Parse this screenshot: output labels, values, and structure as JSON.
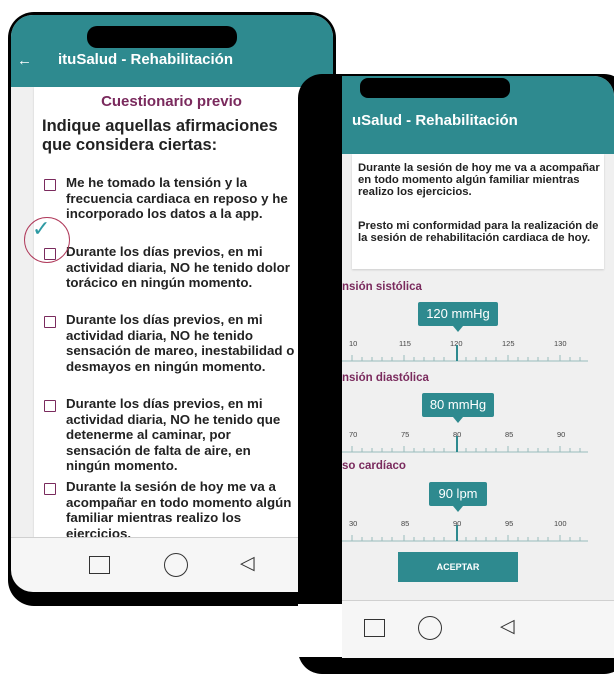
{
  "left_screen": {
    "app_title": "ituSalud - Rehabilitación",
    "back_icon": "arrow-left-icon",
    "questionnaire_title": "Cuestionario previo",
    "instruction": "Indique aquellas afirmaciones que considera ciertas:",
    "statements": [
      {
        "text": "Me he tomado la tensión y la frecuencia cardiaca en reposo y he incorporado los datos a la app.",
        "checked": false
      },
      {
        "text": "Durante los días previos, en mi actividad diaria, NO he tenido dolor torácico en ningún momento.",
        "checked": false
      },
      {
        "text": "Durante los días previos, en mi actividad diaria, NO he tenido sensación de mareo, inestabilidad o desmayos en ningún momento.",
        "checked": false
      },
      {
        "text": "Durante los días previos, en mi actividad diaria, NO he tenido que detenerme al caminar, por sensación de falta de aire, en ningún momento.",
        "checked": false
      },
      {
        "text": "Durante la sesión de hoy me va a acompañar en todo momento algún familiar mientras realizo los ejercicios.",
        "checked": false
      }
    ],
    "annotation_icon": "checkmark-icon"
  },
  "right_screen": {
    "app_title": "uSalud - Rehabilitación",
    "card_paragraph_1": "Durante la sesión de hoy me va a acompañar en todo momento algún familiar mientras realizo los ejercicios.",
    "card_paragraph_2": "Presto mi conformidad para la realización de la sesión de rehabilitación cardiaca de hoy.",
    "sliders": [
      {
        "label": "nsión sistólica",
        "value_text": "120 mmHg",
        "value": 120,
        "ticks": [
          "10",
          "115",
          "120",
          "125",
          "130"
        ]
      },
      {
        "label": "nsión diastólica",
        "value_text": "80 mmHg",
        "value": 80,
        "ticks": [
          "70",
          "75",
          "80",
          "85",
          "90"
        ]
      },
      {
        "label": "so cardíaco",
        "value_text": "90 lpm",
        "value": 90,
        "ticks": [
          "30",
          "85",
          "90",
          "95",
          "100"
        ]
      }
    ],
    "accept_button": "ACEPTAR"
  },
  "nav_icons": {
    "recents": "square-icon",
    "home": "circle-icon",
    "back": "triangle-back-icon"
  },
  "colors": {
    "primary": "#2e8a8f",
    "accent": "#7a2a5d",
    "annotation": "#b03a5b"
  }
}
